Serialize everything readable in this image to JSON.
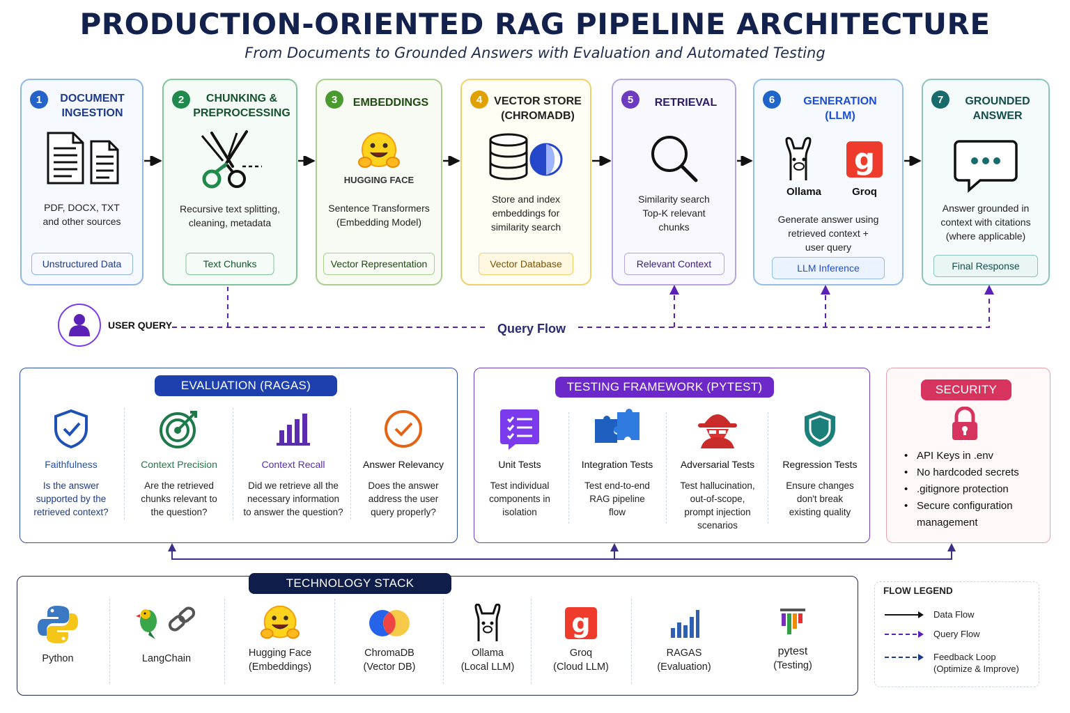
{
  "title": "PRODUCTION-ORIENTED RAG PIPELINE ARCHITECTURE",
  "subtitle": "From Documents to Grounded Answers with Evaluation and Automated Testing",
  "stages": [
    {
      "num": "1",
      "title": [
        "DOCUMENT",
        "INGESTION"
      ],
      "desc": [
        "PDF, DOCX, TXT",
        "and other sources"
      ],
      "chip": "Unstructured Data",
      "icon": "document-icon",
      "color": "#2563c9"
    },
    {
      "num": "2",
      "title": [
        "CHUNKING &",
        "PREPROCESSING"
      ],
      "desc": [
        "Recursive text splitting,",
        "cleaning, metadata"
      ],
      "chip": "Text Chunks",
      "icon": "scissors-icon",
      "color": "#1f8a4c"
    },
    {
      "num": "3",
      "title": [
        "EMBEDDINGS"
      ],
      "brand": "HUGGING FACE",
      "desc": [
        "Sentence Transformers",
        "(Embedding Model)"
      ],
      "chip": "Vector Representation",
      "icon": "hugging-face-icon",
      "color": "#4a9a2f"
    },
    {
      "num": "4",
      "title": [
        "VECTOR STORE",
        "(CHROMADB)"
      ],
      "desc": [
        "Store and index",
        "embeddings for",
        "similarity search"
      ],
      "chip": "Vector Database",
      "icon": "database-icon",
      "color": "#e0a100"
    },
    {
      "num": "5",
      "title": [
        "RETRIEVAL"
      ],
      "desc": [
        "Similarity search",
        "Top-K relevant",
        "chunks"
      ],
      "chip": "Relevant Context",
      "icon": "magnifier-icon",
      "color": "#6d3bbf"
    },
    {
      "num": "6",
      "title": [
        "GENERATION",
        "(LLM)"
      ],
      "brands": [
        "Ollama",
        "Groq"
      ],
      "desc": [
        "Generate answer using",
        "retrieved context +",
        "user query"
      ],
      "chip": "LLM Inference",
      "icon": "llm-icon",
      "color": "#1f66c8"
    },
    {
      "num": "7",
      "title": [
        "GROUNDED",
        "ANSWER"
      ],
      "desc": [
        "Answer grounded in",
        "context with citations",
        "(where applicable)"
      ],
      "chip": "Final Response",
      "icon": "chat-bubble-icon",
      "color": "#176b6b"
    }
  ],
  "user_query": {
    "label": "USER QUERY",
    "flow_label": "Query Flow"
  },
  "evaluation": {
    "title": "EVALUATION (RAGAS)",
    "metrics": [
      {
        "name": "Faithfulness",
        "desc": [
          "Is the answer",
          "supported by the",
          "retrieved context?"
        ],
        "icon": "shield-check-icon"
      },
      {
        "name": "Context Precision",
        "desc": [
          "Are the retrieved",
          "chunks relevant to",
          "the question?"
        ],
        "icon": "target-icon"
      },
      {
        "name": "Context Recall",
        "desc": [
          "Did we retrieve all the",
          "necessary information",
          "to answer the question?"
        ],
        "icon": "bar-chart-icon"
      },
      {
        "name": "Answer Relevancy",
        "desc": [
          "Does the answer",
          "address the user",
          "query properly?"
        ],
        "icon": "check-circle-icon"
      }
    ]
  },
  "testing": {
    "title": "TESTING FRAMEWORK (PYTEST)",
    "tests": [
      {
        "name": "Unit Tests",
        "desc": [
          "Test individual",
          "components in",
          "isolation"
        ],
        "icon": "checklist-icon"
      },
      {
        "name": "Integration Tests",
        "desc": [
          "Test end-to-end",
          "RAG pipeline",
          "flow"
        ],
        "icon": "puzzle-icon"
      },
      {
        "name": "Adversarial Tests",
        "desc": [
          "Test hallucination,",
          "out-of-scope,",
          "prompt injection",
          "scenarios"
        ],
        "icon": "hacker-icon"
      },
      {
        "name": "Regression Tests",
        "desc": [
          "Ensure changes",
          "don't break",
          "existing quality"
        ],
        "icon": "shield-icon"
      }
    ]
  },
  "security": {
    "title": "SECURITY",
    "items": [
      "API Keys in .env",
      "No hardcoded secrets",
      ".gitignore protection",
      "Secure configuration management"
    ]
  },
  "tech_stack": {
    "title": "TECHNOLOGY STACK",
    "items": [
      {
        "name": [
          "Python"
        ],
        "icon": "python-icon"
      },
      {
        "name": [
          "LangChain"
        ],
        "icon": "langchain-icon"
      },
      {
        "name": [
          "Hugging Face",
          "(Embeddings)"
        ],
        "icon": "hugging-face-icon"
      },
      {
        "name": [
          "ChromaDB",
          "(Vector DB)"
        ],
        "icon": "chromadb-icon"
      },
      {
        "name": [
          "Ollama",
          "(Local LLM)"
        ],
        "icon": "ollama-icon"
      },
      {
        "name": [
          "Groq",
          "(Cloud LLM)"
        ],
        "icon": "groq-icon"
      },
      {
        "name": [
          "RAGAS",
          "(Evaluation)"
        ],
        "icon": "ragas-icon"
      },
      {
        "name": [
          "pytest",
          "(Testing)"
        ],
        "icon": "pytest-icon"
      }
    ]
  },
  "legend": {
    "title": "FLOW LEGEND",
    "items": [
      {
        "label": [
          "Data Flow"
        ],
        "style": "solid"
      },
      {
        "label": [
          "Query Flow"
        ],
        "style": "dashed"
      },
      {
        "label": [
          "Feedback Loop",
          "(Optimize & Improve)"
        ],
        "style": "dashed"
      }
    ]
  }
}
